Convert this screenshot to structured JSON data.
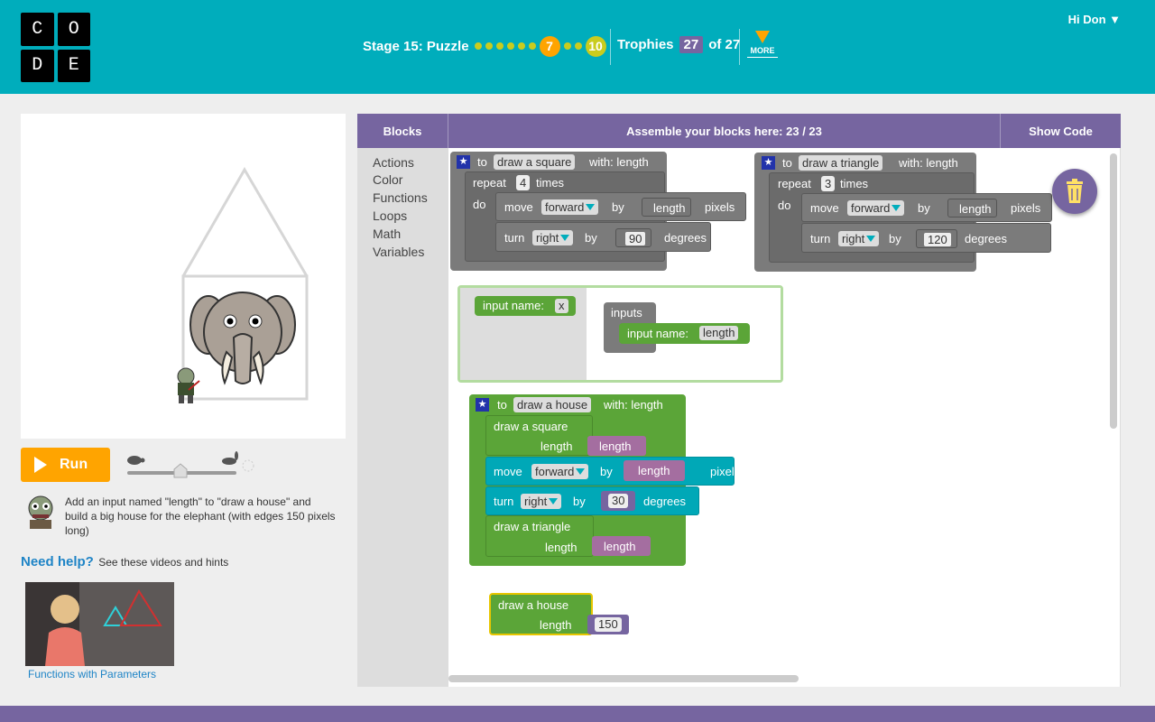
{
  "header": {
    "logo_letters": [
      "C",
      "O",
      "D",
      "E"
    ],
    "stage_label": "Stage 15: Puzzle",
    "current_puzzle": "7",
    "last_puzzle": "10",
    "trophies_label": "Trophies",
    "trophies_count": "27",
    "trophies_total": "of 27",
    "more_label": "MORE",
    "user_label": "Hi Don ▼"
  },
  "left": {
    "run_label": "Run",
    "instructions": "Add an input named \"length\" to \"draw a house\" and build a big house for the elephant (with edges 150 pixels long)",
    "help_title": "Need help?",
    "help_text": "See these videos and hints",
    "video_caption": "Functions with Parameters"
  },
  "workspace": {
    "tab_blocks": "Blocks",
    "assemble_label": "Assemble your blocks here: 23 / 23",
    "show_code": "Show Code",
    "toolbox": [
      "Actions",
      "Color",
      "Functions",
      "Loops",
      "Math",
      "Variables"
    ]
  },
  "blocks": {
    "to": "to",
    "with_length": "with: length",
    "square_name": "draw a square",
    "triangle_name": "draw a triangle",
    "house_name": "draw a house",
    "repeat": "repeat",
    "times": "times",
    "do": "do",
    "move": "move",
    "forward": "forward",
    "by": "by",
    "length": "length",
    "pixels": "pixels",
    "turn": "turn",
    "right": "right",
    "degrees": "degrees",
    "sq_repeat": "4",
    "sq_turn": "90",
    "tri_repeat": "3",
    "tri_turn": "120",
    "house_turn": "30",
    "input_name": "input name:",
    "input_x": "x",
    "inputs": "inputs",
    "call_square": "draw a square",
    "call_triangle": "draw a triangle",
    "call_house": "draw a house",
    "house_value": "150"
  },
  "colors": {
    "header": "#00adbc",
    "accent": "#7665a0",
    "run": "#ffa400",
    "function_block": "#7b7b7b",
    "green_block": "#5ba538",
    "teal_block": "#00a8b7",
    "param_block": "#a46ea0"
  }
}
